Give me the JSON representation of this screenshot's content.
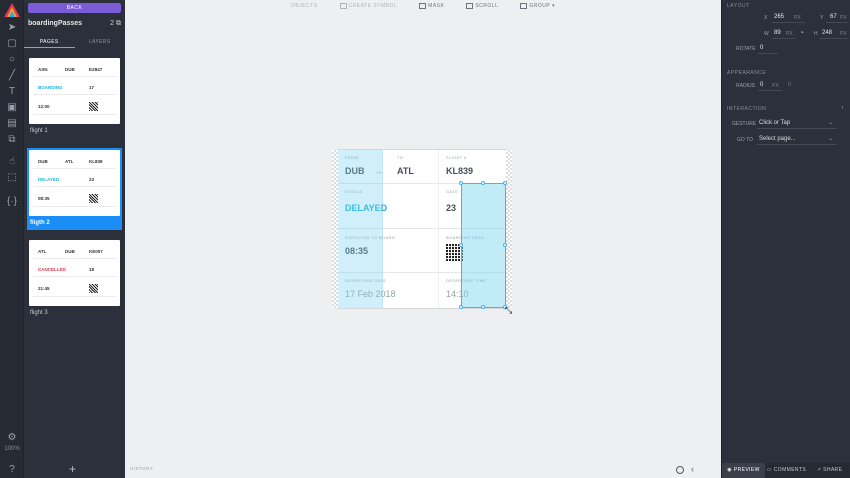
{
  "sidebar": {
    "back_label": "BACK",
    "doc_title": "boardingPasses",
    "doc_count": "2",
    "tabs": [
      {
        "label": "PAGES"
      },
      {
        "label": "LAYERS"
      }
    ],
    "pages": [
      {
        "label": "flight 1",
        "from": "ASN",
        "to": "DUB",
        "flight": "EZ847",
        "status": "BOARDING",
        "gate": "17",
        "time": "12:00"
      },
      {
        "label": "fligth 2",
        "from": "DUB",
        "to": "ATL",
        "flight": "KL839",
        "status": "DELAYED",
        "gate": "23",
        "time": "08:35"
      },
      {
        "label": "flight 3",
        "from": "ATL",
        "to": "DUB",
        "flight": "KE007",
        "status": "CANCELLED",
        "gate": "18",
        "time": "21:45"
      }
    ],
    "zoom": "100%"
  },
  "toolbar": {
    "objects": "OBJECTS",
    "symbol": "CREATE SYMBOL",
    "mask": "MASK",
    "scroll": "SCROLL",
    "group": "GROUP"
  },
  "canvas": {
    "history_label": "HISTORY",
    "artboard": {
      "from_label": "FROM",
      "to_label": "TO",
      "flight_label": "FLIGHT #",
      "from": "DUB",
      "arrow": "→",
      "to": "ATL",
      "flight": "KL839",
      "status_label": "STATUS",
      "status": "DELAYED",
      "gate_label": "GATE",
      "gate": "23",
      "expected_label": "EXPECTED TO BOARD",
      "expected": "08:35",
      "pass_label": "BOARDING PASS",
      "date_label": "DEPARTURE DATE",
      "date": "17 Feb 2018",
      "time_label": "DEPARTURE TIME",
      "time": "14:10"
    }
  },
  "inspector": {
    "layout_title": "LAYOUT",
    "x_label": "X",
    "x": "265",
    "x_unit": "PX",
    "y_label": "Y",
    "y": "67",
    "y_unit": "PX",
    "w_label": "W",
    "w": "89",
    "w_unit": "PX",
    "h_label": "H",
    "h": "248",
    "h_unit": "PX",
    "rotate_label": "ROTATE",
    "rotate": "0",
    "appearance_title": "APPEARANCE",
    "radius_label": "RADIUS",
    "radius": "0",
    "radius_unit": "PX",
    "interaction_title": "INTERACTION",
    "gesture_label": "GESTURE",
    "gesture": "Click or Tap",
    "goto_label": "GO TO",
    "goto": "Select page...",
    "bottom_tabs": [
      {
        "label": "PREVIEW"
      },
      {
        "label": "COMMENTS"
      },
      {
        "label": "SHARE"
      }
    ]
  },
  "colors": {
    "accent": "#1a8df7",
    "back": "#7b5cd6",
    "delayed": "#1fb3d8",
    "boarding": "#1fb3d8",
    "cancelled": "#e0324f"
  }
}
